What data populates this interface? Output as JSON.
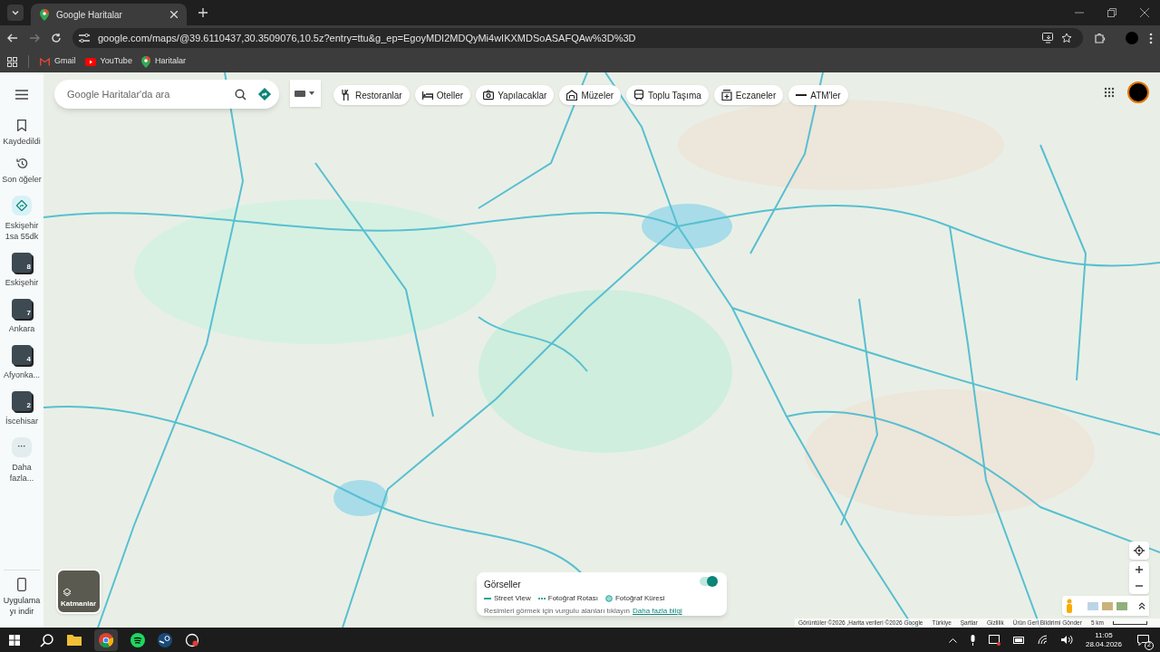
{
  "browser": {
    "tabs": [
      {
        "title": "Google Haritalar",
        "selected": true
      }
    ],
    "url": "google.com/maps/@39.6110437,30.3509076,10.5z?entry=ttu&g_ep=EgoyMDI2MDQyMi4wIKXMDSoASAFQAw%3D%3D",
    "bookmarks": [
      {
        "label": "Gmail",
        "kind": "gmail"
      },
      {
        "label": "YouTube",
        "kind": "youtube"
      },
      {
        "label": "Haritalar",
        "kind": "maps"
      }
    ]
  },
  "sidebar": {
    "items": [
      {
        "kind": "saved",
        "label": "Kaydedildi"
      },
      {
        "kind": "recent",
        "label": "Son öğeler"
      },
      {
        "kind": "route",
        "label": "Eskişehir 1sa 55dk"
      },
      {
        "kind": "photo",
        "label": "Eskişehir",
        "count": "8"
      },
      {
        "kind": "photo",
        "label": "Ankara",
        "count": "7"
      },
      {
        "kind": "photo",
        "label": "Afyonka...",
        "count": "4"
      },
      {
        "kind": "photo",
        "label": "İscehisar",
        "count": "2"
      },
      {
        "kind": "more",
        "label": "Daha fazla...",
        "icon_text": "···"
      }
    ],
    "download": "Uygulamayı indir"
  },
  "search": {
    "placeholder": "Google Haritalar'da ara"
  },
  "chips": [
    {
      "label": "Restoranlar",
      "kind": "restaurant"
    },
    {
      "label": "Oteller",
      "kind": "hotel"
    },
    {
      "label": "Yapılacaklar",
      "kind": "camera"
    },
    {
      "label": "Müzeler",
      "kind": "museum"
    },
    {
      "label": "Toplu Taşıma",
      "kind": "transit"
    },
    {
      "label": "Eczaneler",
      "kind": "pharmacy"
    },
    {
      "label": "ATM'ler",
      "kind": "atm"
    }
  ],
  "layers": {
    "label": "Katmanlar"
  },
  "legend": {
    "title": "Görseller",
    "items": [
      {
        "label": "Street View",
        "kind": "line"
      },
      {
        "label": "Fotoğraf Rotası",
        "kind": "dashed"
      },
      {
        "label": "Fotoğraf Küresi",
        "kind": "circle"
      }
    ],
    "hint": "Resimleri görmek için vurgulu alanları tıklayın",
    "link": "Daha fazla bilgi",
    "toggle_on": true
  },
  "attribution": [
    "Görüntüler ©2026 ,Harita verileri ©2026 Google",
    "Türkiye",
    "Şartlar",
    "Gizlilik",
    "Ürün Geri Bildirimi Gönder"
  ],
  "scale": "5 km",
  "taskbar": {
    "time": "11:05",
    "date": "28.04.2026",
    "notifications": "2"
  }
}
